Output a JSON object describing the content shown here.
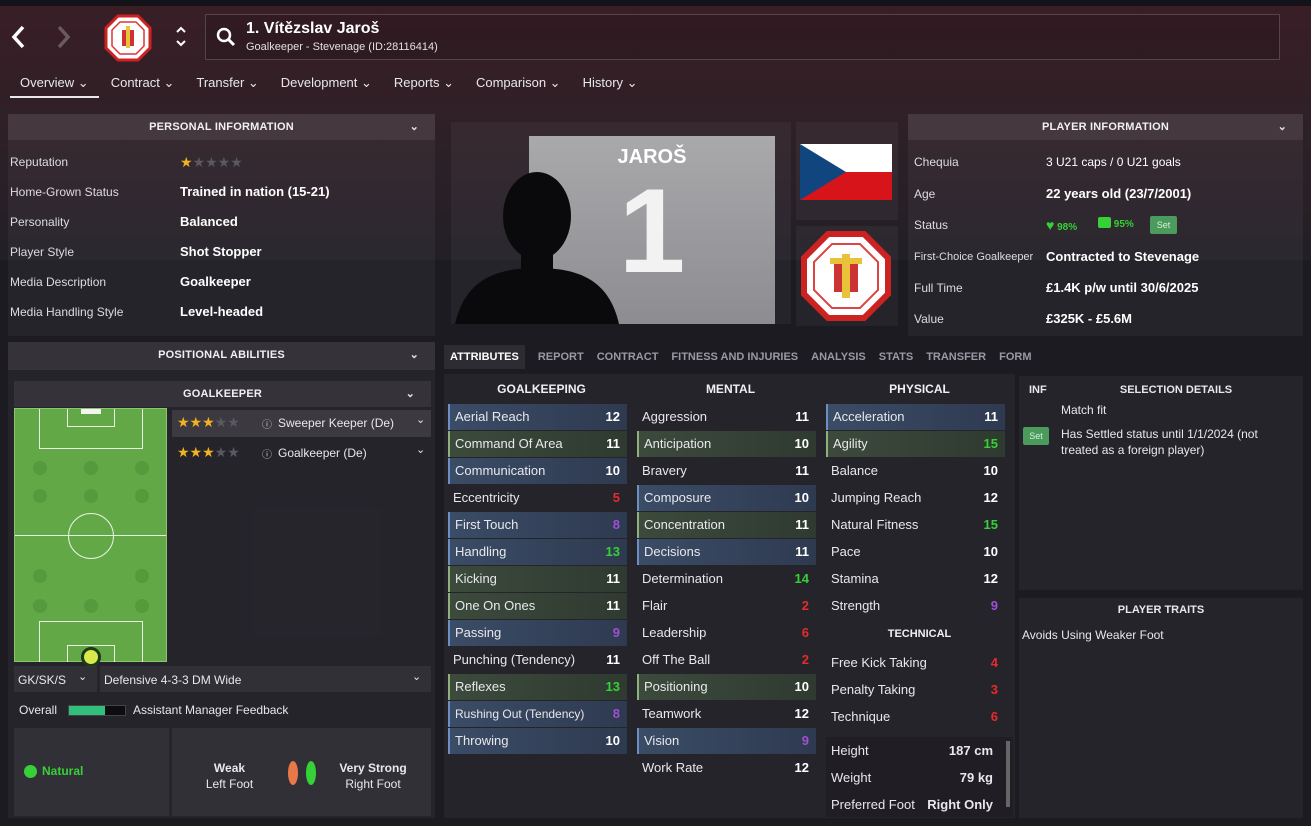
{
  "header": {
    "player_name": "1. Vítězslav Jaroš",
    "subtitle": "Goalkeeper - Stevenage (ID:28116414)"
  },
  "tabs": [
    "Overview",
    "Contract",
    "Transfer",
    "Development",
    "Reports",
    "Comparison",
    "History"
  ],
  "personal_info": {
    "title": "PERSONAL INFORMATION",
    "rows": [
      {
        "label": "Reputation",
        "value": ""
      },
      {
        "label": "Home-Grown Status",
        "value": "Trained in nation (15-21)"
      },
      {
        "label": "Personality",
        "value": "Balanced"
      },
      {
        "label": "Player Style",
        "value": "Shot Stopper"
      },
      {
        "label": "Media Description",
        "value": "Goalkeeper"
      },
      {
        "label": "Media Handling Style",
        "value": "Level-headed"
      }
    ],
    "reputation_stars": 1
  },
  "shirt": {
    "name": "JAROŠ",
    "number": "1"
  },
  "player_info": {
    "title": "PLAYER INFORMATION",
    "rows": [
      {
        "label": "Chequia",
        "value": "3 U21 caps / 0 U21 goals"
      },
      {
        "label": "Age",
        "value": "22 years old (23/7/2001)"
      },
      {
        "label": "Status",
        "value": ""
      },
      {
        "label": "First-Choice Goalkeeper",
        "value": "Contracted to Stevenage"
      },
      {
        "label": "Full Time",
        "value": "£1.4K p/w until 30/6/2025"
      },
      {
        "label": "Value",
        "value": "£325K - £5.6M"
      }
    ],
    "condition": "98%",
    "sharpness": "95%",
    "set_label": "Set"
  },
  "positional": {
    "title": "POSITIONAL ABILITIES",
    "sub_title": "GOALKEEPER",
    "roles": [
      {
        "name": "Sweeper Keeper (De)",
        "stars": 3
      },
      {
        "name": "Goalkeeper (De)",
        "stars": 3
      }
    ],
    "role_select": "GK/SK/S",
    "tactic_select": "Defensive 4-3-3 DM Wide",
    "overall_label": "Overall",
    "feedback_label": "Assistant Manager Feedback",
    "natural_label": "Natural",
    "weak_title": "Weak",
    "weak_sub": "Left Foot",
    "strong_title": "Very Strong",
    "strong_sub": "Right Foot"
  },
  "subtabs": [
    "ATTRIBUTES",
    "REPORT",
    "CONTRACT",
    "FITNESS AND INJURIES",
    "ANALYSIS",
    "STATS",
    "TRANSFER",
    "FORM"
  ],
  "attributes": {
    "goalkeeping_title": "GOALKEEPING",
    "goalkeeping": [
      {
        "name": "Aerial Reach",
        "value": "12"
      },
      {
        "name": "Command Of Area",
        "value": "11"
      },
      {
        "name": "Communication",
        "value": "10"
      },
      {
        "name": "Eccentricity",
        "value": "5"
      },
      {
        "name": "First Touch",
        "value": "8"
      },
      {
        "name": "Handling",
        "value": "13"
      },
      {
        "name": "Kicking",
        "value": "11"
      },
      {
        "name": "One On Ones",
        "value": "11"
      },
      {
        "name": "Passing",
        "value": "9"
      },
      {
        "name": "Punching (Tendency)",
        "value": "11"
      },
      {
        "name": "Reflexes",
        "value": "13"
      },
      {
        "name": "Rushing Out (Tendency)",
        "value": "8"
      },
      {
        "name": "Throwing",
        "value": "10"
      }
    ],
    "mental_title": "MENTAL",
    "mental": [
      {
        "name": "Aggression",
        "value": "11"
      },
      {
        "name": "Anticipation",
        "value": "10"
      },
      {
        "name": "Bravery",
        "value": "11"
      },
      {
        "name": "Composure",
        "value": "10"
      },
      {
        "name": "Concentration",
        "value": "11"
      },
      {
        "name": "Decisions",
        "value": "11"
      },
      {
        "name": "Determination",
        "value": "14"
      },
      {
        "name": "Flair",
        "value": "2"
      },
      {
        "name": "Leadership",
        "value": "6"
      },
      {
        "name": "Off The Ball",
        "value": "2"
      },
      {
        "name": "Positioning",
        "value": "10"
      },
      {
        "name": "Teamwork",
        "value": "12"
      },
      {
        "name": "Vision",
        "value": "9"
      },
      {
        "name": "Work Rate",
        "value": "12"
      }
    ],
    "physical_title": "PHYSICAL",
    "physical": [
      {
        "name": "Acceleration",
        "value": "11"
      },
      {
        "name": "Agility",
        "value": "15"
      },
      {
        "name": "Balance",
        "value": "10"
      },
      {
        "name": "Jumping Reach",
        "value": "12"
      },
      {
        "name": "Natural Fitness",
        "value": "15"
      },
      {
        "name": "Pace",
        "value": "10"
      },
      {
        "name": "Stamina",
        "value": "12"
      },
      {
        "name": "Strength",
        "value": "9"
      }
    ],
    "technical_title": "TECHNICAL",
    "technical": [
      {
        "name": "Free Kick Taking",
        "value": "4"
      },
      {
        "name": "Penalty Taking",
        "value": "3"
      },
      {
        "name": "Technique",
        "value": "6"
      }
    ],
    "body": [
      {
        "name": "Height",
        "value": "187 cm"
      },
      {
        "name": "Weight",
        "value": "79 kg"
      },
      {
        "name": "Preferred Foot",
        "value": "Right Only"
      }
    ]
  },
  "selection": {
    "inf_label": "INF",
    "title": "SELECTION DETAILS",
    "match_fit": "Match fit",
    "set_label": "Set",
    "settled": "Has Settled status until 1/1/2024 (not treated as a foreign player)"
  },
  "traits": {
    "title": "PLAYER TRAITS",
    "items": [
      "Avoids Using Weaker Foot"
    ]
  },
  "colors": {
    "accent": "#6d8fc4",
    "green": "#36d136",
    "red": "#e52b2b",
    "purple": "#a14fd4"
  }
}
